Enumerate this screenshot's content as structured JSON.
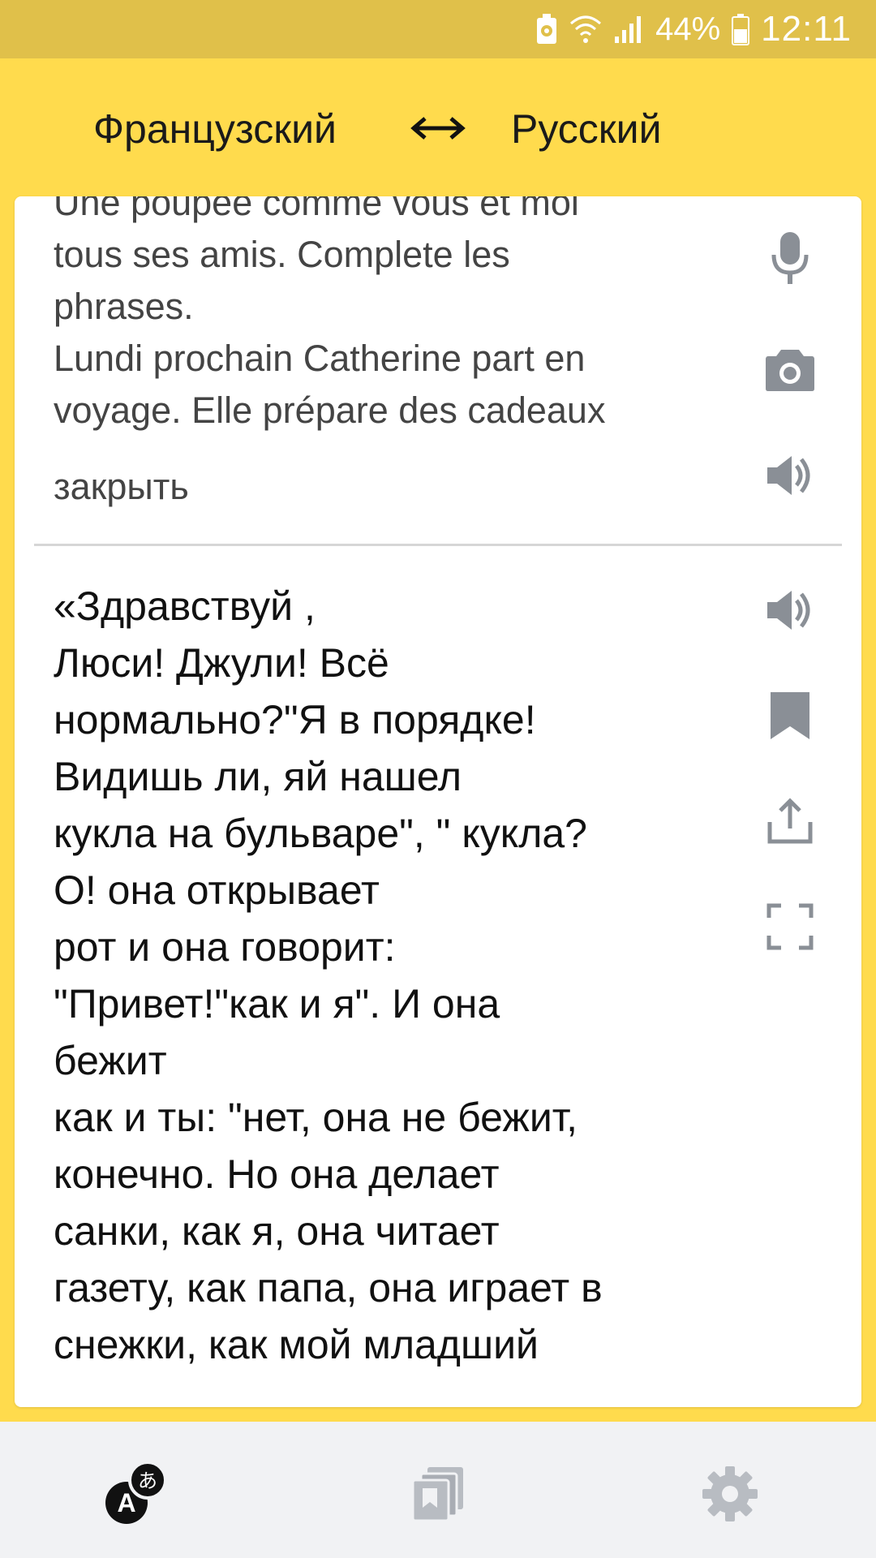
{
  "status_bar": {
    "battery_percent": "44%",
    "time": "12:11",
    "icons": [
      "battery-saver-icon",
      "wifi-icon",
      "signal-icon",
      "battery-icon"
    ]
  },
  "languages": {
    "source": "Французский",
    "target": "Русский",
    "swap_icon": "swap-icon"
  },
  "source": {
    "text": "Une poupée comme vous et moi\ntous ses amis. Complete les\nphrases.\nLundi prochain Catherine part en\nvoyage. Elle prépare des cadeaux",
    "close_hint": "закрыть",
    "icons": [
      "microphone-icon",
      "camera-icon",
      "speaker-icon"
    ]
  },
  "translation": {
    "text": "«Здравствуй ,\nЛюси! Джули! Всё\nнормально?\"Я в порядке!\nВидишь ли, яй нашел\nкукла на бульваре\", \" кукла?\nО! она открывает\nрот и она говорит:\n\"Привет!\"как и я\". И она\nбежит\nкак и ты: \"нет, она не бежит,\nконечно. Но она делает\nсанки, как я, она читает\nгазету, как папа, она играет в\nснежки, как мой младший",
    "icons": [
      "speaker-icon",
      "bookmark-icon",
      "share-icon",
      "fullscreen-icon"
    ]
  },
  "bottom_nav": {
    "items": [
      "translate-icon",
      "collections-icon",
      "settings-icon"
    ],
    "active": "translate-icon"
  },
  "colors": {
    "accent": "#ffdb4d",
    "status_bar": "#e0c04a",
    "icon_gray": "#8a8f96",
    "nav_background": "#f1f2f4"
  }
}
